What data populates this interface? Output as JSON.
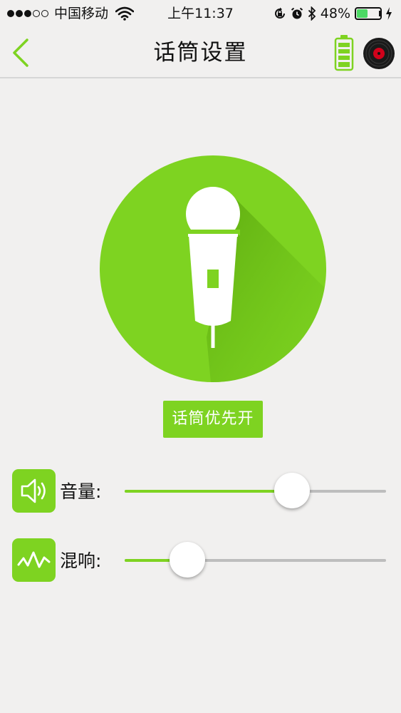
{
  "status_bar": {
    "carrier": "中国移动",
    "time": "上午11:37",
    "battery_percent": "48%",
    "battery_level": 0.48,
    "signal_bars": 3,
    "signal_total": 5
  },
  "nav": {
    "title": "话筒设置",
    "back_icon": "chevron-left-icon",
    "battery_icon": "battery-icon",
    "disc_icon": "vinyl-disc-icon"
  },
  "mic": {
    "icon": "microphone-icon",
    "priority_button_label": "话筒优先开"
  },
  "volume": {
    "label": "音量:",
    "icon": "speaker-icon",
    "level": 0.64
  },
  "reverb": {
    "label": "混响:",
    "icon": "waveform-icon",
    "level": 0.24
  },
  "colors": {
    "accent": "#7ed321",
    "background": "#f1f0ef",
    "track": "#bdbdbd"
  }
}
